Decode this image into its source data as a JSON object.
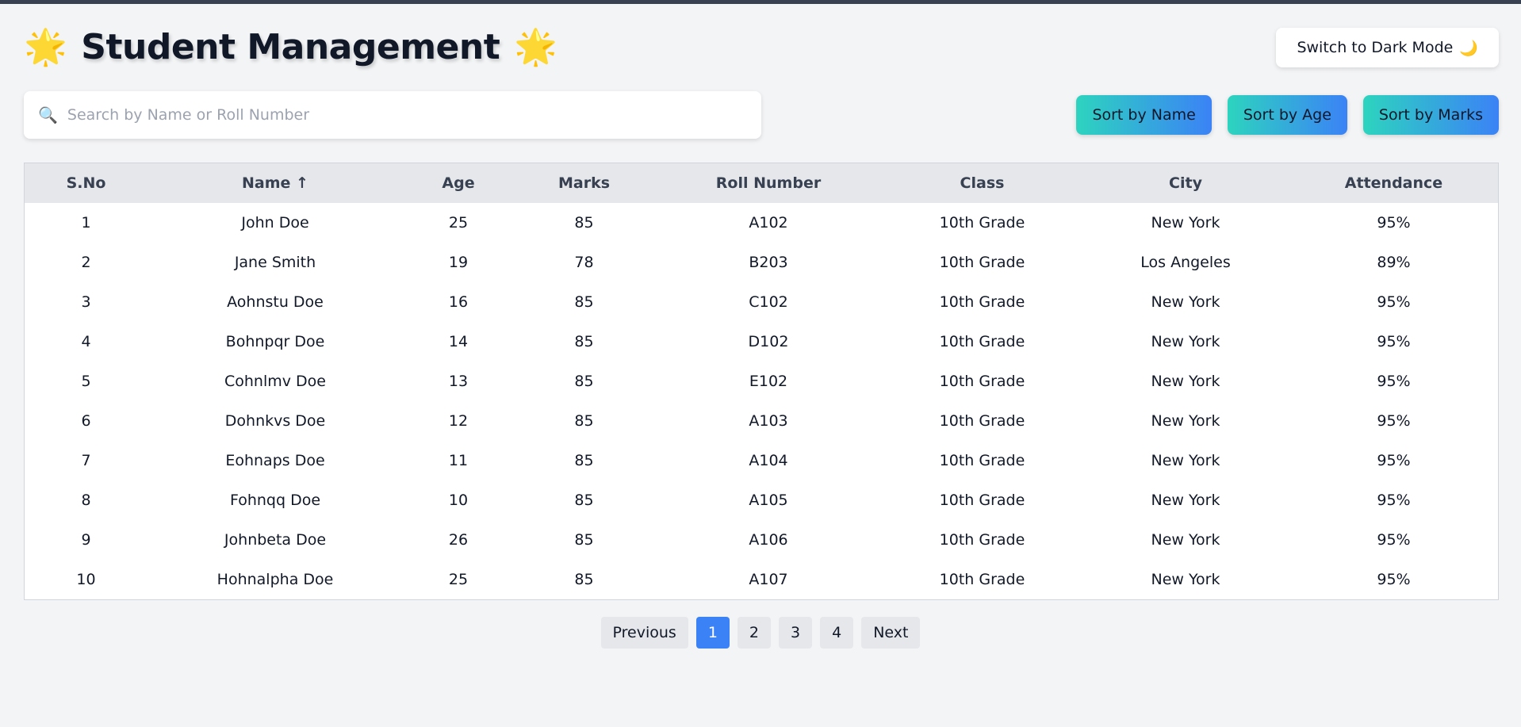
{
  "header": {
    "title": "Student Management",
    "title_emoji": "🌟",
    "mode_button_label": "Switch to Dark Mode",
    "mode_icon": "🌙"
  },
  "search": {
    "icon": "🔍",
    "placeholder": "Search by Name or Roll Number",
    "value": ""
  },
  "sort_buttons": [
    "Sort by Name",
    "Sort by Age",
    "Sort by Marks"
  ],
  "table": {
    "columns": [
      "S.No",
      "Name ↑",
      "Age",
      "Marks",
      "Roll Number",
      "Class",
      "City",
      "Attendance"
    ],
    "rows": [
      [
        "1",
        "John Doe",
        "25",
        "85",
        "A102",
        "10th Grade",
        "New York",
        "95%"
      ],
      [
        "2",
        "Jane Smith",
        "19",
        "78",
        "B203",
        "10th Grade",
        "Los Angeles",
        "89%"
      ],
      [
        "3",
        "Aohnstu Doe",
        "16",
        "85",
        "C102",
        "10th Grade",
        "New York",
        "95%"
      ],
      [
        "4",
        "Bohnpqr Doe",
        "14",
        "85",
        "D102",
        "10th Grade",
        "New York",
        "95%"
      ],
      [
        "5",
        "Cohnlmv Doe",
        "13",
        "85",
        "E102",
        "10th Grade",
        "New York",
        "95%"
      ],
      [
        "6",
        "Dohnkvs Doe",
        "12",
        "85",
        "A103",
        "10th Grade",
        "New York",
        "95%"
      ],
      [
        "7",
        "Eohnaps Doe",
        "11",
        "85",
        "A104",
        "10th Grade",
        "New York",
        "95%"
      ],
      [
        "8",
        "Fohnqq Doe",
        "10",
        "85",
        "A105",
        "10th Grade",
        "New York",
        "95%"
      ],
      [
        "9",
        "Johnbeta Doe",
        "26",
        "85",
        "A106",
        "10th Grade",
        "New York",
        "95%"
      ],
      [
        "10",
        "Hohnalpha Doe",
        "25",
        "85",
        "A107",
        "10th Grade",
        "New York",
        "95%"
      ]
    ]
  },
  "pagination": {
    "previous_label": "Previous",
    "next_label": "Next",
    "pages": [
      "1",
      "2",
      "3",
      "4"
    ],
    "current_page": "1"
  },
  "colors": {
    "background": "#f3f4f6",
    "accent": "#3b82f6",
    "sort_gradient_start": "#2dd4bf",
    "sort_gradient_end": "#3b82f6"
  }
}
